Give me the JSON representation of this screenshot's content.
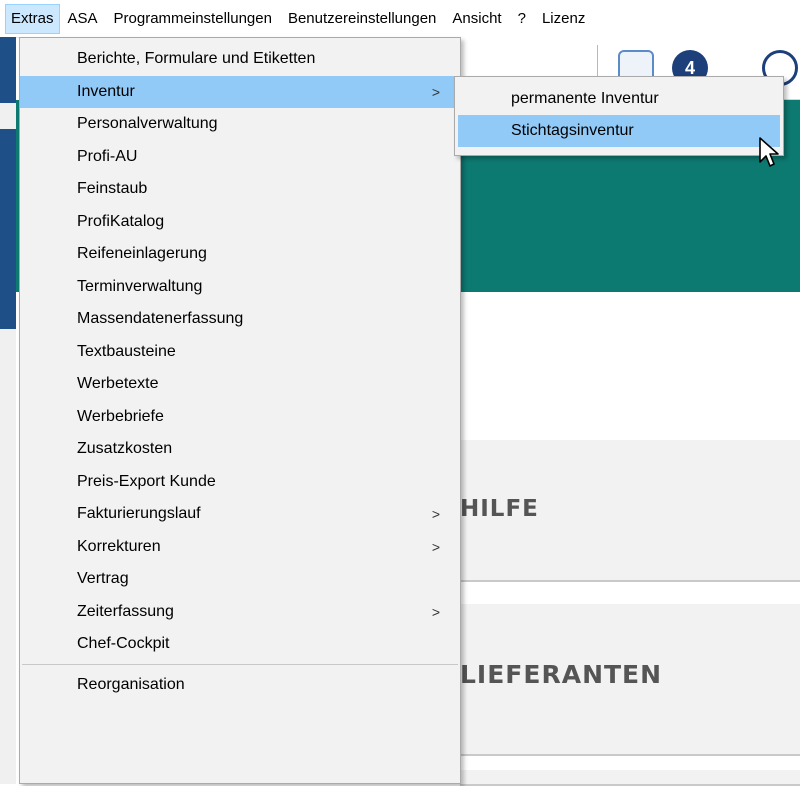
{
  "menubar": {
    "items": [
      "Extras",
      "ASA",
      "Programmeinstellungen",
      "Benutzereinstellungen",
      "Ansicht",
      "?",
      "Lizenz"
    ]
  },
  "extras_menu": {
    "items": [
      {
        "label": "Berichte, Formulare und Etiketten",
        "submenu": false
      },
      {
        "label": "Inventur",
        "submenu": true,
        "highlighted": true
      },
      {
        "label": "Personalverwaltung",
        "submenu": false
      },
      {
        "label": "Profi-AU",
        "submenu": false
      },
      {
        "label": "Feinstaub",
        "submenu": false
      },
      {
        "label": "ProfiKatalog",
        "submenu": false
      },
      {
        "label": "Reifeneinlagerung",
        "submenu": false
      },
      {
        "label": "Terminverwaltung",
        "submenu": false
      },
      {
        "label": "Massendatenerfassung",
        "submenu": false
      },
      {
        "label": "Textbausteine",
        "submenu": false
      },
      {
        "label": "Werbetexte",
        "submenu": false
      },
      {
        "label": "Werbebriefe",
        "submenu": false
      },
      {
        "label": "Zusatzkosten",
        "submenu": false
      },
      {
        "label": "Preis-Export Kunde",
        "submenu": false
      },
      {
        "label": "Fakturierungslauf",
        "submenu": true
      },
      {
        "label": "Korrekturen",
        "submenu": true
      },
      {
        "label": "Vertrag",
        "submenu": false
      },
      {
        "label": "Zeiterfassung",
        "submenu": true
      },
      {
        "label": "Chef-Cockpit",
        "submenu": false
      }
    ],
    "after_separator": [
      "Reorganisation"
    ],
    "submenu_arrow": ">"
  },
  "inventur_submenu": {
    "items": [
      "permanente Inventur",
      "Stichtagsinventur"
    ],
    "highlighted_index": 1
  },
  "background": {
    "toolbar_badge": "4",
    "card1_title": "HILFE",
    "card2_title": "LIEFERANTEN",
    "teal_color": "#0d7a72",
    "highlight_color": "#91c9f7"
  }
}
